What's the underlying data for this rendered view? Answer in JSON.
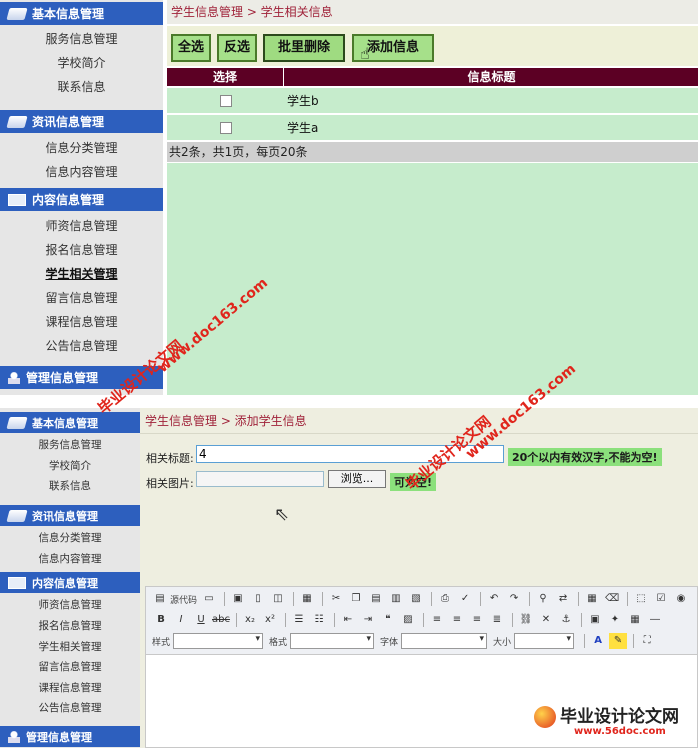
{
  "top": {
    "sidebar": {
      "sections": [
        {
          "title": "基本信息管理",
          "items": [
            "服务信息管理",
            "学校简介",
            "联系信息"
          ]
        },
        {
          "title": "资讯信息管理",
          "items": [
            "信息分类管理",
            "信息内容管理"
          ]
        },
        {
          "title": "内容信息管理",
          "items": [
            "师资信息管理",
            "报名信息管理",
            "学生相关管理",
            "留言信息管理",
            "课程信息管理",
            "公告信息管理"
          ]
        },
        {
          "title": "管理信息管理",
          "items": []
        }
      ],
      "active_item": "学生相关管理"
    },
    "breadcrumb": "学生信息管理 > 学生相关信息",
    "buttons": {
      "select_all": "全选",
      "invert": "反选",
      "batch_delete": "批里删除",
      "add": "添加信息"
    },
    "table": {
      "headers": [
        "选择",
        "信息标题"
      ],
      "rows": [
        {
          "title": "学生b"
        },
        {
          "title": "学生a"
        }
      ]
    },
    "pager": "共2条，共1页，每页20条"
  },
  "bottom": {
    "sidebar": {
      "sections": [
        {
          "title": "基本信息管理",
          "items": [
            "服务信息管理",
            "学校简介",
            "联系信息"
          ]
        },
        {
          "title": "资讯信息管理",
          "items": [
            "信息分类管理",
            "信息内容管理"
          ]
        },
        {
          "title": "内容信息管理",
          "items": [
            "师资信息管理",
            "报名信息管理",
            "学生相关管理",
            "留言信息管理",
            "课程信息管理",
            "公告信息管理"
          ]
        },
        {
          "title": "管理信息管理",
          "items": []
        }
      ]
    },
    "breadcrumb": "学生信息管理 > 添加学生信息",
    "form": {
      "title_label": "相关标题:",
      "title_value": "4",
      "title_hint": "20个以内有效汉字,不能为空!",
      "image_label": "相关图片:",
      "browse_label": "浏览...",
      "image_hint": "可为空!"
    },
    "editor": {
      "source_label": "源代码",
      "style_label": "样式",
      "format_label": "格式",
      "font_label": "字体",
      "size_label": "大小"
    }
  },
  "watermarks": {
    "site": "www.doc163.com",
    "brand": "毕业设计论文网",
    "logo_url": "www.56doc.com"
  },
  "colors": {
    "sidebar_header": "#2d5fbe",
    "table_header": "#5c0024",
    "row_bg": "#c6eccc",
    "button_bg": "#a6e08a",
    "hint_bg": "#8be07c",
    "breadcrumb_text": "#a0233a"
  }
}
